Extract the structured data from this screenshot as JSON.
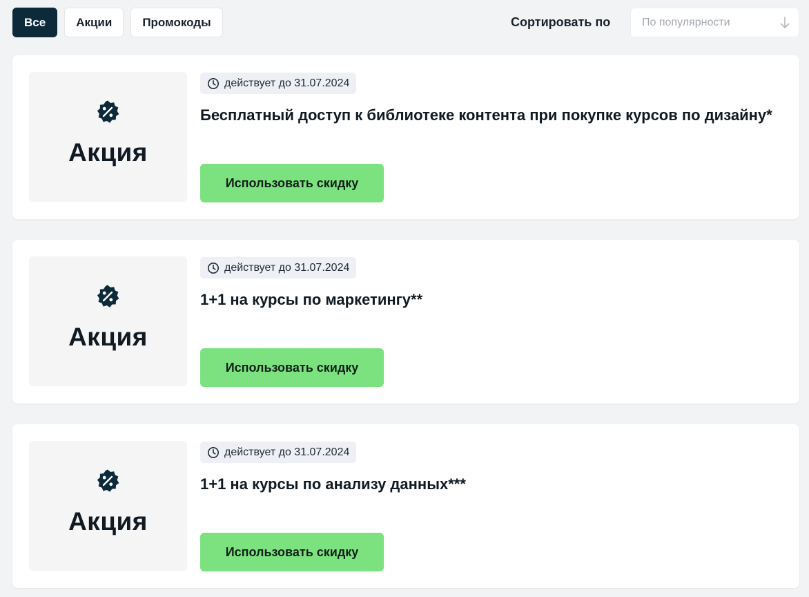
{
  "filters": {
    "tabs": [
      {
        "label": "Все",
        "active": true
      },
      {
        "label": "Акции",
        "active": false
      },
      {
        "label": "Промокоды",
        "active": false
      }
    ]
  },
  "sort": {
    "label": "Сортировать по",
    "selected": "По популярности",
    "icon": "arrow-down-icon"
  },
  "colors": {
    "active_tab": "#0d2a3b",
    "button": "#7be27f",
    "background": "#f2f3f5"
  },
  "cards": [
    {
      "image_label": "Акция",
      "icon": "discount-badge-icon",
      "validity": "действует до 31.07.2024",
      "title": "Бесплатный доступ к библиотеке контента при покупке курсов по дизайну*",
      "button_label": "Использовать скидку"
    },
    {
      "image_label": "Акция",
      "icon": "discount-badge-icon",
      "validity": "действует до 31.07.2024",
      "title": "1+1 на курсы по маркетингу**",
      "button_label": "Использовать скидку"
    },
    {
      "image_label": "Акция",
      "icon": "discount-badge-icon",
      "validity": "действует до 31.07.2024",
      "title": "1+1 на курсы по анализу данных***",
      "button_label": "Использовать скидку"
    }
  ]
}
